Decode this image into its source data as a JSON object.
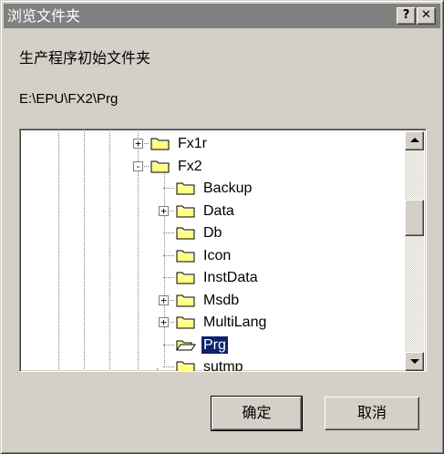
{
  "window": {
    "title": "浏览文件夹",
    "help_label": "?",
    "close_label": "✕"
  },
  "dialog": {
    "prompt": "生产程序初始文件夹",
    "path": "E:\\EPU\\FX2\\Prg"
  },
  "tree": {
    "items": [
      {
        "label": "Fx1r",
        "level": 0,
        "expander": "+",
        "selected": false
      },
      {
        "label": "Fx2",
        "level": 0,
        "expander": "-",
        "selected": false
      },
      {
        "label": "Backup",
        "level": 1,
        "expander": "",
        "selected": false
      },
      {
        "label": "Data",
        "level": 1,
        "expander": "+",
        "selected": false
      },
      {
        "label": "Db",
        "level": 1,
        "expander": "",
        "selected": false
      },
      {
        "label": "Icon",
        "level": 1,
        "expander": "",
        "selected": false
      },
      {
        "label": "InstData",
        "level": 1,
        "expander": "",
        "selected": false
      },
      {
        "label": "Msdb",
        "level": 1,
        "expander": "+",
        "selected": false
      },
      {
        "label": "MultiLang",
        "level": 1,
        "expander": "+",
        "selected": false
      },
      {
        "label": "Prg",
        "level": 1,
        "expander": "",
        "selected": true
      },
      {
        "label": "sutmp",
        "level": 1,
        "expander": "",
        "selected": false
      }
    ],
    "scroll_position": 0.3
  },
  "buttons": {
    "ok": "确定",
    "cancel": "取消"
  },
  "colors": {
    "titlebar": "#808080",
    "face": "#d4d0c8",
    "selection": "#0a246a",
    "folder": "#ffff80"
  },
  "icons": {
    "folder": "folder-icon",
    "open_folder": "open-folder-icon"
  }
}
